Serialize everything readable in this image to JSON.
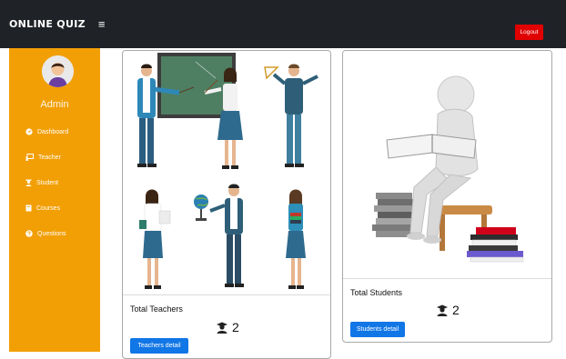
{
  "header": {
    "brand": "ONLINE QUIZ",
    "menu_icon": "≡",
    "logout_label": "Logout"
  },
  "sidebar": {
    "user_name": "Admin",
    "items": [
      {
        "label": "Dashboard",
        "icon": "dashboard-icon"
      },
      {
        "label": "Teacher",
        "icon": "chalkboard-icon"
      },
      {
        "label": "Student",
        "icon": "student-icon"
      },
      {
        "label": "Courses",
        "icon": "book-icon"
      },
      {
        "label": "Questions",
        "icon": "question-icon"
      }
    ]
  },
  "cards": {
    "teachers": {
      "title": "Total Teachers",
      "count": "2",
      "button_label": "Teachers detail"
    },
    "students": {
      "title": "Total Students",
      "count": "2",
      "button_label": "Students detail"
    }
  },
  "colors": {
    "topbar": "#1f2226",
    "sidebar": "#f29f05",
    "logout": "#e00000",
    "primary_button": "#1176e6"
  }
}
